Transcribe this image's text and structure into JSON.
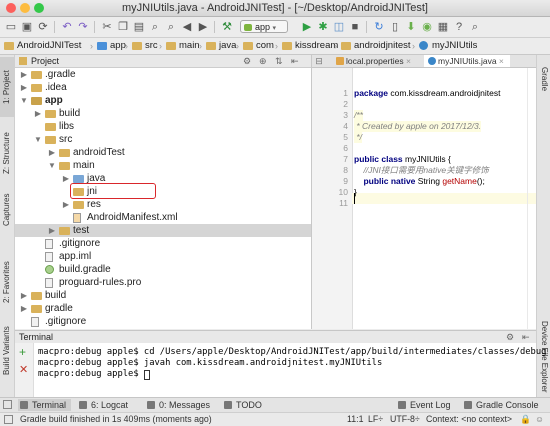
{
  "window": {
    "title": "myJNIUtils.java - AndroidJNITest] - [~/Desktop/AndroidJNITest]"
  },
  "toolbar": {
    "run_config": "app"
  },
  "breadcrumb": [
    "AndroidJNITest",
    "app",
    "src",
    "main",
    "java",
    "com",
    "kissdream",
    "androidjnitest",
    "myJNIUtils"
  ],
  "project_panel": {
    "title": "Project",
    "tree": [
      {
        "label": ".gradle",
        "depth": 0,
        "arrow": "right",
        "icon": "folder"
      },
      {
        "label": ".idea",
        "depth": 0,
        "arrow": "right",
        "icon": "folder"
      },
      {
        "label": "app",
        "depth": 0,
        "arrow": "down",
        "icon": "module-folder",
        "bold": true
      },
      {
        "label": "build",
        "depth": 1,
        "arrow": "right",
        "icon": "folder"
      },
      {
        "label": "libs",
        "depth": 1,
        "arrow": "",
        "icon": "folder"
      },
      {
        "label": "src",
        "depth": 1,
        "arrow": "down",
        "icon": "folder"
      },
      {
        "label": "androidTest",
        "depth": 2,
        "arrow": "right",
        "icon": "folder"
      },
      {
        "label": "main",
        "depth": 2,
        "arrow": "down",
        "icon": "folder"
      },
      {
        "label": "java",
        "depth": 3,
        "arrow": "right",
        "icon": "source-folder"
      },
      {
        "label": "jni",
        "depth": 3,
        "arrow": "",
        "icon": "folder"
      },
      {
        "label": "res",
        "depth": 3,
        "arrow": "right",
        "icon": "folder"
      },
      {
        "label": "AndroidManifest.xml",
        "depth": 3,
        "arrow": "",
        "icon": "xml-file"
      },
      {
        "label": "test",
        "depth": 2,
        "arrow": "right",
        "icon": "folder",
        "selected": true
      },
      {
        "label": ".gitignore",
        "depth": 1,
        "arrow": "",
        "icon": "file"
      },
      {
        "label": "app.iml",
        "depth": 1,
        "arrow": "",
        "icon": "file"
      },
      {
        "label": "build.gradle",
        "depth": 1,
        "arrow": "",
        "icon": "gradle-file"
      },
      {
        "label": "proguard-rules.pro",
        "depth": 1,
        "arrow": "",
        "icon": "file"
      },
      {
        "label": "build",
        "depth": 0,
        "arrow": "right",
        "icon": "folder"
      },
      {
        "label": "gradle",
        "depth": 0,
        "arrow": "right",
        "icon": "folder"
      },
      {
        "label": ".gitignore",
        "depth": 0,
        "arrow": "",
        "icon": "file"
      }
    ]
  },
  "editor": {
    "tabs": [
      {
        "label": "local.properties",
        "active": false
      },
      {
        "label": "myJNIUtils.java",
        "active": true
      }
    ],
    "line_numbers": [
      "1",
      "2",
      "3",
      "4",
      "5",
      "6",
      "7",
      "8",
      "9",
      "10",
      "11"
    ],
    "code": {
      "l1_kw": "package",
      "l1_rest": " com.kissdream.androidjnitest",
      "l3": "/**",
      "l4": " * Created by apple on 2017/12/3.",
      "l5": " */",
      "l7_kw": "public class",
      "l7_rest": " myJNIUtils {",
      "l8": "    //JNI接口需要用native关键字修饰",
      "l9_kw": "    public native",
      "l9_type": " String ",
      "l9_fn": "getName",
      "l9_end": "();",
      "l10": "}"
    }
  },
  "terminal": {
    "title": "Terminal",
    "lines": [
      "macpro:debug apple$ cd /Users/apple/Desktop/AndroidJNITest/app/build/intermediates/classes/debug",
      "macpro:debug apple$ javah com.kissdream.androidjnitest.myJNIUtils",
      "macpro:debug apple$ "
    ]
  },
  "left_strip": [
    "1: Project",
    "Z: Structure",
    "Captures",
    "2: Favorites",
    "Build Variants"
  ],
  "right_strip": [
    "Gradle",
    "Device File Explorer"
  ],
  "bottom_tabs": [
    {
      "label": "Terminal",
      "active": true
    },
    {
      "label": "6: Logcat",
      "active": false
    },
    {
      "label": "0: Messages",
      "active": false
    },
    {
      "label": "TODO",
      "active": false
    },
    {
      "label": "Event Log",
      "active": false
    },
    {
      "label": "Gradle Console",
      "active": false
    }
  ],
  "status": {
    "message": "Gradle build finished in 1s 409ms (moments ago)",
    "position": "11:1",
    "line_sep": "LF÷",
    "encoding": "UTF-8÷",
    "context": "Context: <no context>"
  }
}
